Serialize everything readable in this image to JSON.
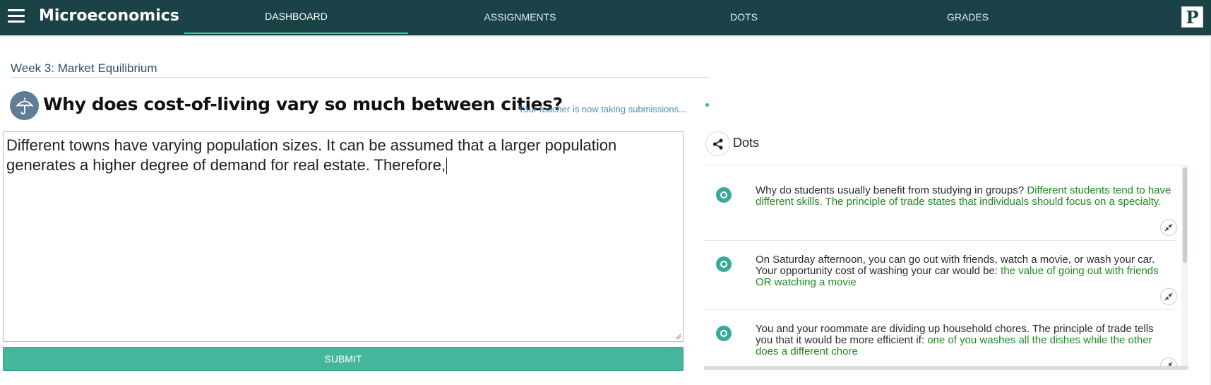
{
  "header": {
    "app_title": "Microeconomics",
    "menu_icon": "hamburger-menu-icon",
    "tabs": [
      {
        "label": "DASHBOARD",
        "active": true
      },
      {
        "label": "ASSIGNMENTS",
        "active": false
      },
      {
        "label": "DOTS",
        "active": false
      },
      {
        "label": "GRADES",
        "active": false
      }
    ],
    "logo_letter": "P"
  },
  "lesson": {
    "week_label": "Week 3: Market Equilibrium",
    "question_icon": "umbrella-icon",
    "question_title": "Why does cost-of-living vary so much between cities?",
    "teacher_status": "Your teacher is now taking submissions..."
  },
  "answer": {
    "text": "Different towns have varying population sizes. It can be assumed that a larger population generates a higher degree of demand for real estate. Therefore,",
    "submit_label": "SUBMIT"
  },
  "dots": {
    "title": "Dots",
    "share_icon": "share-icon",
    "items": [
      {
        "question": "Why do students usually benefit from studying in groups? ",
        "answer": "Different students tend to have different skills. The principle of trade states that individuals should focus on a specialty."
      },
      {
        "question": "On Saturday afternoon, you can go out with friends, watch a movie, or wash your car. Your opportunity cost of washing your car would be: ",
        "answer": "the value of going out with friends OR watching a movie"
      },
      {
        "question": "You and your roommate are dividing up household chores. The principle of trade tells you that it would be more efficient if: ",
        "answer": "one of you washes all the dishes while the other does a different chore"
      }
    ]
  },
  "colors": {
    "header_bg": "#1b4347",
    "accent": "#45b69c",
    "answer_green": "#1f8a1f",
    "status_blue": "#4b8fb0"
  }
}
